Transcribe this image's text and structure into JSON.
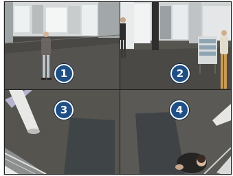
{
  "cameras": [
    {
      "number": "1"
    },
    {
      "number": "2"
    },
    {
      "number": "3"
    },
    {
      "number": "4"
    }
  ],
  "colors": {
    "badge_fill": "#1f4f85",
    "badge_border": "#ffffff",
    "divider": "#1b1b1b"
  }
}
